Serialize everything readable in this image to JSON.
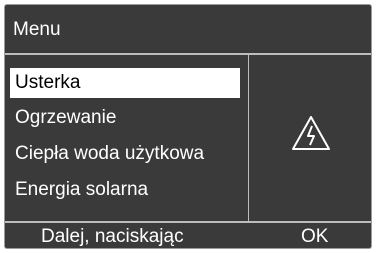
{
  "title": "Menu",
  "menu": {
    "items": [
      {
        "label": "Usterka",
        "selected": true
      },
      {
        "label": "Ogrzewanie",
        "selected": false
      },
      {
        "label": "Ciepła woda użytkowa",
        "selected": false
      },
      {
        "label": "Energia solarna",
        "selected": false
      }
    ]
  },
  "status_icon": "warning-high-voltage-icon",
  "footer": {
    "hint": "Dalej, naciskając",
    "ok_label": "OK"
  },
  "colors": {
    "background": "#3a3a3a",
    "text": "#ffffff",
    "selection": "#ffffff",
    "divider": "#bdbdbd"
  }
}
